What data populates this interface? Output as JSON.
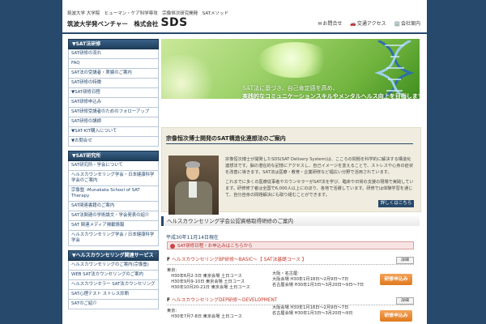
{
  "header": {
    "tagline": "筑波大学 大学院　ヒューマン・ケア科学専攻　宗像恒次研究開発　SATメソッド",
    "brand_prefix": "筑波大学発ベンチャー　株式会社",
    "brand_name": "SDS",
    "links": [
      "お問合せ",
      "交通アクセス",
      "会社案内"
    ]
  },
  "sidebar": {
    "section1_title": "▼SAT法研修",
    "section1_items": [
      "SAT研修の流れ",
      "FAQ",
      "SAT法の受講者・実績のご案内",
      "SAT研修の特徴",
      "▼SAT研修日程",
      "SAT研修申込み",
      "SAT研修受講者のためのフォローアップ",
      "SAT研修の講師",
      "▼SAT-KIT購入について",
      "▼お問合せ"
    ],
    "section2_title": "▼SAT研究所",
    "section2_items": [
      "SAT研究所・学会について",
      "ヘルスカウンセリング学会・日本健康科学学会のご案内",
      "宗像塾 -Munakata School of SAT Therapy",
      "SAT関連書籍のご案内",
      "SAT法関連の学術論文・学会発表の紹介",
      "SAT 関連メディア掲載情報",
      "ヘルスカウンセリング学会 / 日本健康科学学会"
    ],
    "section3_title": "▼ヘルスカウンセリング関連サービス",
    "section3_items": [
      "ヘルスカウンセリングのご案内(宗像塾)",
      "WEB SAT法カウンセリングのご案内",
      "ヘルスカウンセラー SAT法カウンセリング",
      "SAT心理テスト ストレス診断",
      "SATのご紹介"
    ]
  },
  "banner": {
    "line1": "SAT法に基づき、自己肯定感を高め、",
    "line2": "実践的なコミュニケーションスキルやメンタルヘルス向上を目指します"
  },
  "intro": {
    "title": "宗像恒次博士開発のSAT構造化連想法のご案内",
    "para1": "宗像恒次博士が開発したSDS(SAT Delivery System)は、こころの問題を科学的に解決する構造化連想法です。脳の潜在的な記憶にアクセスし、自己イメージを変えることで、ストレスや心身の症状を改善に導きます。SAT法は医療・教育・企業研修など幅広い分野で活用されています。",
    "para2": "これまでに多くの医療従事者やカウンセラーがSAT法を学び、臨床や日常の支援の現場で実践しています。研修修了者は全国で6,000人以上にのぼり、各地で活躍しています。研修では体験学習を通じて、自分自身の問題解決にも取り組むことができます。",
    "button": "詳しくはこちら"
  },
  "courses": {
    "heading": "ヘルスカウンセリング学会公認資格取得研修のご案内",
    "date": "平成30年11月14日現在",
    "notice": "SAT研修日程・お申込みはこちらから",
    "detail_label": "詳細",
    "apply_label": "研修申込み",
    "items": [
      {
        "title": "ヘルスカウンセリングBP研修～BASIC～【 SAT法基礎コース 】",
        "schedule_left": [
          "東京:",
          "　H30年6月2-3日 東京会場 土日コース",
          "　H30年9月9-10日 東京会場 土日コース",
          "　H30年10月20-21日 東京会場 土日コース"
        ],
        "schedule_right": [
          "大阪・名古屋:",
          "大阪会場 H30年1月18日〜2月9日〜7日",
          "名古屋会場 H30年1月3日〜3月20日〜9日〜7日"
        ]
      },
      {
        "title": "ヘルスカウンセリングDEP研修～DEVELOPMENT",
        "schedule_left": [
          "東京:",
          "　H30年7月7-8日 東京会場 土日コース"
        ],
        "schedule_right": [
          "大阪会場 H30年1月18日〜2月9日〜7日",
          "名古屋会場 H30年1月3日〜3月20日〜9日"
        ]
      }
    ]
  }
}
